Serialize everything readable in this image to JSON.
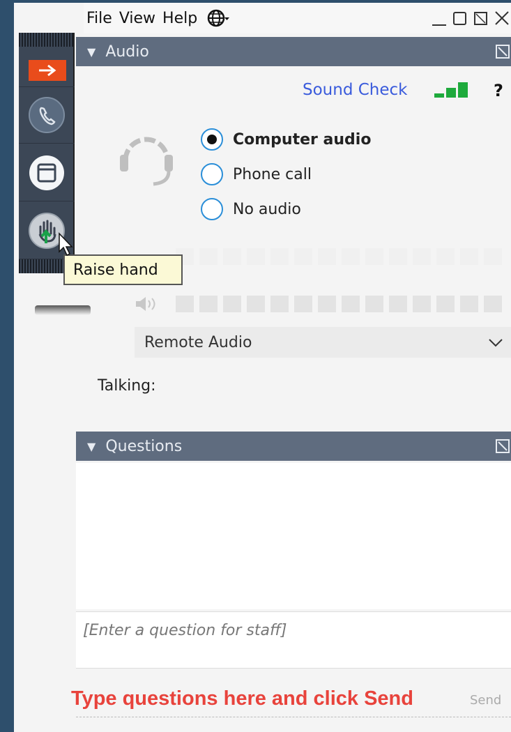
{
  "menubar": {
    "items": [
      "File",
      "View",
      "Help"
    ],
    "globe_icon": "globe-icon"
  },
  "window_controls": [
    "minimize-icon",
    "maximize-icon",
    "restore-icon",
    "close-icon"
  ],
  "control_panel": {
    "buttons": [
      "arrow-icon",
      "phone-icon",
      "dashboard-icon",
      "raise-hand-icon"
    ],
    "accent": "#e94c1b"
  },
  "tooltip": {
    "text": "Raise hand"
  },
  "audio": {
    "header": "Audio",
    "sound_check": "Sound Check",
    "help": "?",
    "options": [
      {
        "label": "Computer audio",
        "selected": true
      },
      {
        "label": "Phone call",
        "selected": false
      },
      {
        "label": "No audio",
        "selected": false
      }
    ],
    "audio_device": "Remote Audio",
    "talking_label": "Talking:"
  },
  "questions": {
    "header": "Questions",
    "placeholder": "[Enter a question for staff]",
    "instruction": "Type questions here and click Send",
    "send_label": "Send"
  },
  "colors": {
    "header_bg": "#5f6c7f",
    "link": "#3a5bdc",
    "signal": "#1eaa3c",
    "radio_border": "#2a8ed8",
    "instruction": "#e8433c"
  }
}
